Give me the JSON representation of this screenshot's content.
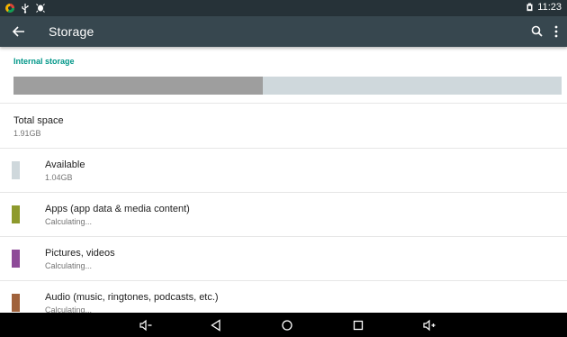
{
  "status_bar": {
    "time": "11:23",
    "icons": [
      "app-notification-icon",
      "usb-icon",
      "debug-icon",
      "battery-icon"
    ]
  },
  "app_bar": {
    "title": "Storage",
    "icons": [
      "back-arrow-icon",
      "search-icon",
      "more-vert-icon"
    ]
  },
  "storage": {
    "section_title": "Internal storage",
    "used_fraction": 0.455,
    "colors": {
      "used": "#9e9e9e",
      "free": "#cfd8dc",
      "accent": "#009688"
    }
  },
  "items": [
    {
      "title": "Total space",
      "subtitle": "1.91GB"
    },
    {
      "title": "Available",
      "subtitle": "1.04GB",
      "color": "#cfd8dc"
    },
    {
      "title": "Apps (app data & media content)",
      "subtitle": "Calculating...",
      "color": "#8e9a2d"
    },
    {
      "title": "Pictures, videos",
      "subtitle": "Calculating...",
      "color": "#8e4b98"
    },
    {
      "title": "Audio (music, ringtones, podcasts, etc.)",
      "subtitle": "Calculating...",
      "color": "#a0623c"
    }
  ],
  "nav_bar": {
    "buttons": [
      "volume-down-icon",
      "back-icon",
      "home-icon",
      "recents-icon",
      "volume-up-icon"
    ]
  }
}
